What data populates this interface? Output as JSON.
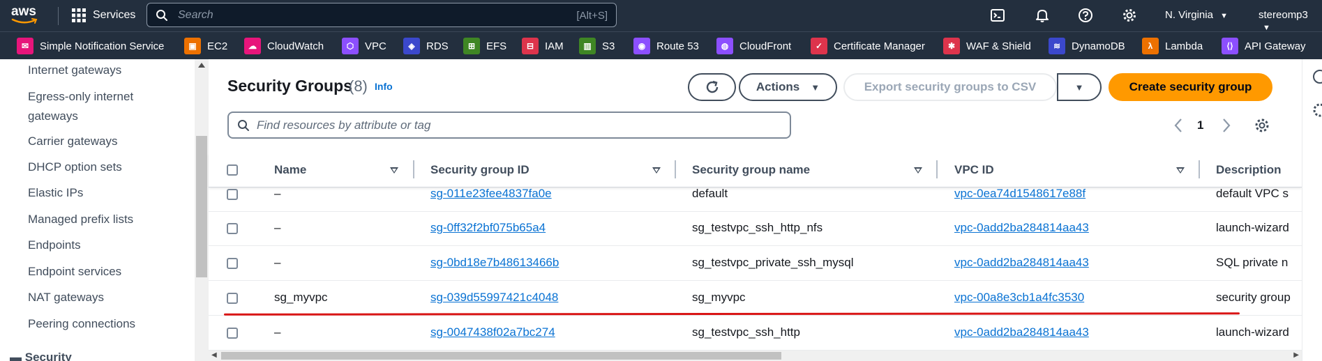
{
  "topbar": {
    "logo_text": "aws",
    "services_label": "Services",
    "search_placeholder": "Search",
    "search_shortcut": "[Alt+S]",
    "region": "N. Virginia",
    "user": "stereomp3"
  },
  "favorites": [
    {
      "label": "Simple Notification Service",
      "color": "#e7157b",
      "icon": "sns-icon"
    },
    {
      "label": "EC2",
      "color": "#ed7100",
      "icon": "ec2-icon"
    },
    {
      "label": "CloudWatch",
      "color": "#e7157b",
      "icon": "cloudwatch-icon"
    },
    {
      "label": "VPC",
      "color": "#8c4fff",
      "icon": "vpc-icon"
    },
    {
      "label": "RDS",
      "color": "#3b48cc",
      "icon": "rds-icon"
    },
    {
      "label": "EFS",
      "color": "#3f8624",
      "icon": "efs-icon"
    },
    {
      "label": "IAM",
      "color": "#dd344c",
      "icon": "iam-icon"
    },
    {
      "label": "S3",
      "color": "#3f8624",
      "icon": "s3-icon"
    },
    {
      "label": "Route 53",
      "color": "#8c4fff",
      "icon": "route53-icon"
    },
    {
      "label": "CloudFront",
      "color": "#8c4fff",
      "icon": "cloudfront-icon"
    },
    {
      "label": "Certificate Manager",
      "color": "#dd344c",
      "icon": "acm-icon"
    },
    {
      "label": "WAF & Shield",
      "color": "#dd344c",
      "icon": "waf-icon"
    },
    {
      "label": "DynamoDB",
      "color": "#3b48cc",
      "icon": "dynamodb-icon"
    },
    {
      "label": "Lambda",
      "color": "#ed7100",
      "icon": "lambda-icon"
    },
    {
      "label": "API Gateway",
      "color": "#8c4fff",
      "icon": "apigateway-icon"
    }
  ],
  "sidebar": {
    "items": [
      {
        "label": "Internet gateways"
      },
      {
        "label": "Egress-only internet gateways"
      },
      {
        "label": "Carrier gateways"
      },
      {
        "label": "DHCP option sets"
      },
      {
        "label": "Elastic IPs"
      },
      {
        "label": "Managed prefix lists"
      },
      {
        "label": "Endpoints"
      },
      {
        "label": "Endpoint services"
      },
      {
        "label": "NAT gateways"
      },
      {
        "label": "Peering connections"
      }
    ],
    "section_partial": "Security"
  },
  "header": {
    "title": "Security Groups",
    "count": "(8)",
    "info": "Info",
    "actions_label": "Actions",
    "export_label": "Export security groups to CSV",
    "create_label": "Create security group"
  },
  "filter": {
    "placeholder": "Find resources by attribute or tag"
  },
  "pagination": {
    "current_page": "1"
  },
  "table": {
    "columns": [
      "Name",
      "Security group ID",
      "Security group name",
      "VPC ID",
      "Description"
    ],
    "rows": [
      {
        "name": "–",
        "sg_id": "sg-011e23fee4837fa0e",
        "sg_name": "default",
        "vpc_id": "vpc-0ea74d1548617e88f",
        "description": "default VPC s"
      },
      {
        "name": "–",
        "sg_id": "sg-0ff32f2bf075b65a4",
        "sg_name": "sg_testvpc_ssh_http_nfs",
        "vpc_id": "vpc-0add2ba284814aa43",
        "description": "launch-wizard"
      },
      {
        "name": "–",
        "sg_id": "sg-0bd18e7b48613466b",
        "sg_name": "sg_testvpc_private_ssh_mysql",
        "vpc_id": "vpc-0add2ba284814aa43",
        "description": "SQL private n"
      },
      {
        "name": "sg_myvpc",
        "sg_id": "sg-039d55997421c4048",
        "sg_name": "sg_myvpc",
        "vpc_id": "vpc-00a8e3cb1a4fc3530",
        "description": "security group"
      },
      {
        "name": "–",
        "sg_id": "sg-0047438f02a7bc274",
        "sg_name": "sg_testvpc_ssh_http",
        "vpc_id": "vpc-0add2ba284814aa43",
        "description": "launch-wizard"
      }
    ]
  },
  "colors": {
    "nav_bg": "#232f3e",
    "primary_button": "#ff9900",
    "link": "#0972d3",
    "highlight_underline": "#d91515"
  }
}
